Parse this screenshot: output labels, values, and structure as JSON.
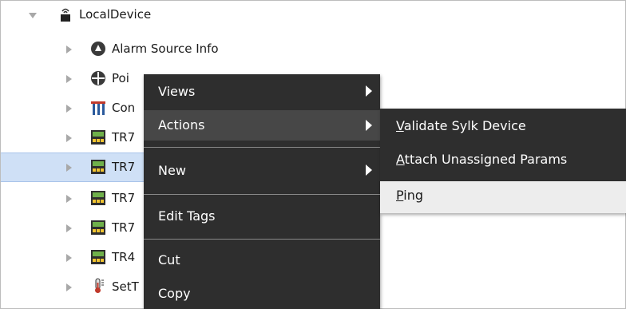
{
  "tree": {
    "root": {
      "label": "LocalDevice",
      "icon": "device-icon"
    },
    "children": [
      {
        "label": "Alarm Source Info",
        "icon": "alarm-icon"
      },
      {
        "label": "Poi",
        "icon": "points-icon"
      },
      {
        "label": "Con",
        "icon": "config-icon"
      },
      {
        "label": "TR7",
        "icon": "controller-icon"
      },
      {
        "label": "TR7",
        "icon": "controller-icon",
        "selected": true
      },
      {
        "label": "TR7",
        "icon": "controller-icon"
      },
      {
        "label": "TR7",
        "icon": "controller-icon"
      },
      {
        "label": "TR4",
        "icon": "controller-icon"
      },
      {
        "label": "SetT",
        "icon": "thermometer-icon"
      }
    ]
  },
  "context_menu": {
    "items": [
      {
        "label": "Views",
        "submenu": true
      },
      {
        "label": "Actions",
        "submenu": true,
        "highlighted": true
      },
      {
        "label": "New",
        "submenu": true
      },
      {
        "label": "Edit Tags",
        "submenu": false
      },
      {
        "label": "Cut",
        "submenu": false
      },
      {
        "label": "Copy",
        "submenu": false
      }
    ]
  },
  "actions_submenu": {
    "items": [
      {
        "first": "V",
        "rest": "alidate Sylk Device"
      },
      {
        "first": "A",
        "rest": "ttach Unassigned Params"
      },
      {
        "first": "P",
        "rest": "ing",
        "hover": true
      }
    ]
  }
}
